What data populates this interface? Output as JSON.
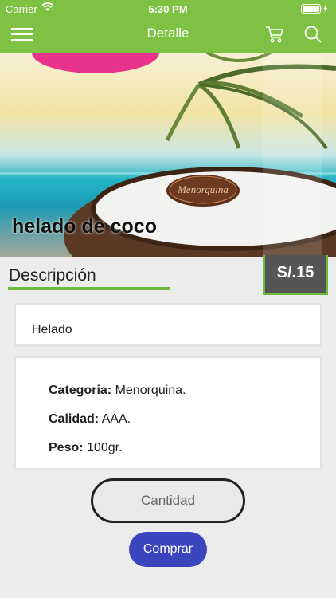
{
  "status_bar": {
    "carrier": "Carrier",
    "time": "5:30 PM"
  },
  "header": {
    "title": "Detalle",
    "left_icon": "hamburger-menu-icon",
    "right_icons": [
      "cart-icon",
      "search-icon"
    ],
    "color": "#7dc242"
  },
  "product": {
    "name": "helado de coco",
    "image_brand_text": "Menorquina",
    "price": "S/.15",
    "section_title": "Descripción",
    "description": "Helado",
    "details": [
      {
        "label": "Categoria:",
        "value": "Menorquina."
      },
      {
        "label": "Calidad:",
        "value": "AAA."
      },
      {
        "label": "Peso:",
        "value": "100gr."
      }
    ]
  },
  "actions": {
    "quantity_placeholder": "Cantidad",
    "buy_label": "Comprar",
    "buy_color": "#3a45bd"
  }
}
